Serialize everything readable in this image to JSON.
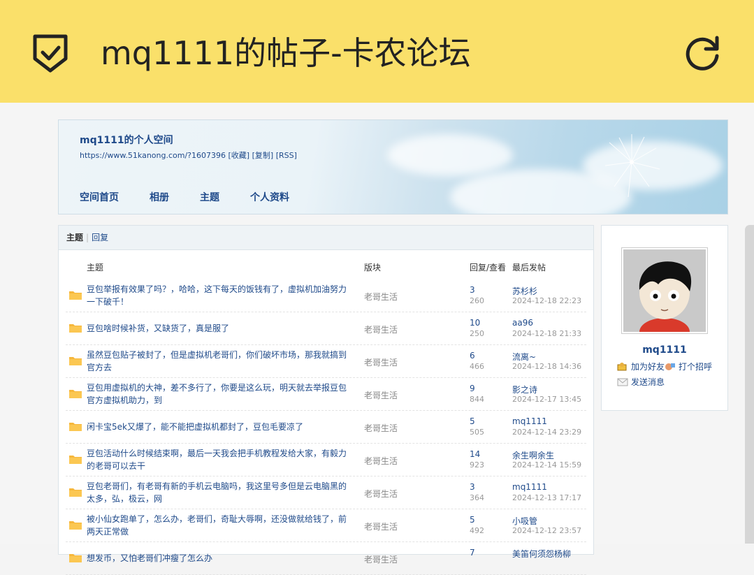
{
  "app": {
    "title": "mq1111的帖子-卡农论坛"
  },
  "space": {
    "title": "mq1111的个人空间",
    "url": "https://www.51kanong.com/?1607396",
    "links": [
      "[收藏]",
      "[复制]",
      "[RSS]"
    ],
    "nav": [
      "空间首页",
      "相册",
      "主题",
      "个人资料"
    ]
  },
  "tabs": {
    "active": "主题",
    "other": "回复"
  },
  "columns": {
    "subject": "主题",
    "forum": "版块",
    "stats": "回复/查看",
    "last": "最后发帖"
  },
  "threads": [
    {
      "subject": "豆包举报有效果了吗？，哈哈，这下每天的饭钱有了，虚拟机加油努力一下破千！",
      "forum": "老哥生活",
      "replies": "3",
      "views": "260",
      "author": "苏杉杉",
      "date": "2024-12-18 22:23"
    },
    {
      "subject": "豆包啥时候补货，又缺货了，真是服了",
      "forum": "老哥生活",
      "replies": "10",
      "views": "250",
      "author": "aa96",
      "date": "2024-12-18 21:33"
    },
    {
      "subject": "虽然豆包贴子被封了，但是虚拟机老哥们，你们破坏市场，那我就搞到官方去",
      "forum": "老哥生活",
      "replies": "6",
      "views": "466",
      "author": "流离~",
      "date": "2024-12-18 14:36"
    },
    {
      "subject": "豆包用虚拟机的大神，差不多行了，你要是这么玩，明天就去举报豆包官方虚拟机助力，到",
      "forum": "老哥生活",
      "replies": "9",
      "views": "844",
      "author": "影之诗",
      "date": "2024-12-17 13:45"
    },
    {
      "subject": "闲卡宝5ek又爆了，能不能把虚拟机都封了，豆包毛要凉了",
      "forum": "老哥生活",
      "replies": "5",
      "views": "505",
      "author": "mq1111",
      "date": "2024-12-14 23:29"
    },
    {
      "subject": "豆包活动什么时候结束啊，最后一天我会把手机教程发给大家，有毅力的老哥可以去干",
      "forum": "老哥生活",
      "replies": "14",
      "views": "923",
      "author": "余生啊余生",
      "date": "2024-12-14 15:59"
    },
    {
      "subject": "豆包老哥们，有老哥有新的手机云电脑吗，我这里号多但是云电脑黑的太多，弘，极云，网",
      "forum": "老哥生活",
      "replies": "3",
      "views": "364",
      "author": "mq1111",
      "date": "2024-12-13 17:17"
    },
    {
      "subject": "被小仙女跑单了，怎么办，老哥们，奇耻大辱啊，还没做就给钱了，前两天正常做",
      "forum": "老哥生活",
      "replies": "5",
      "views": "492",
      "author": "小吸管",
      "date": "2024-12-12 23:57"
    },
    {
      "subject": "想发币，又怕老哥们冲瘦了怎么办",
      "forum": "老哥生活",
      "replies": "7",
      "views": "",
      "author": "美笛何须怨杨柳",
      "date": ""
    }
  ],
  "profile": {
    "username": "mq1111",
    "add_friend": "加为好友",
    "greet": "打个招呼",
    "message": "发送消息"
  },
  "colors": {
    "topbar": "#fae06a",
    "link": "#1f4a8a"
  }
}
